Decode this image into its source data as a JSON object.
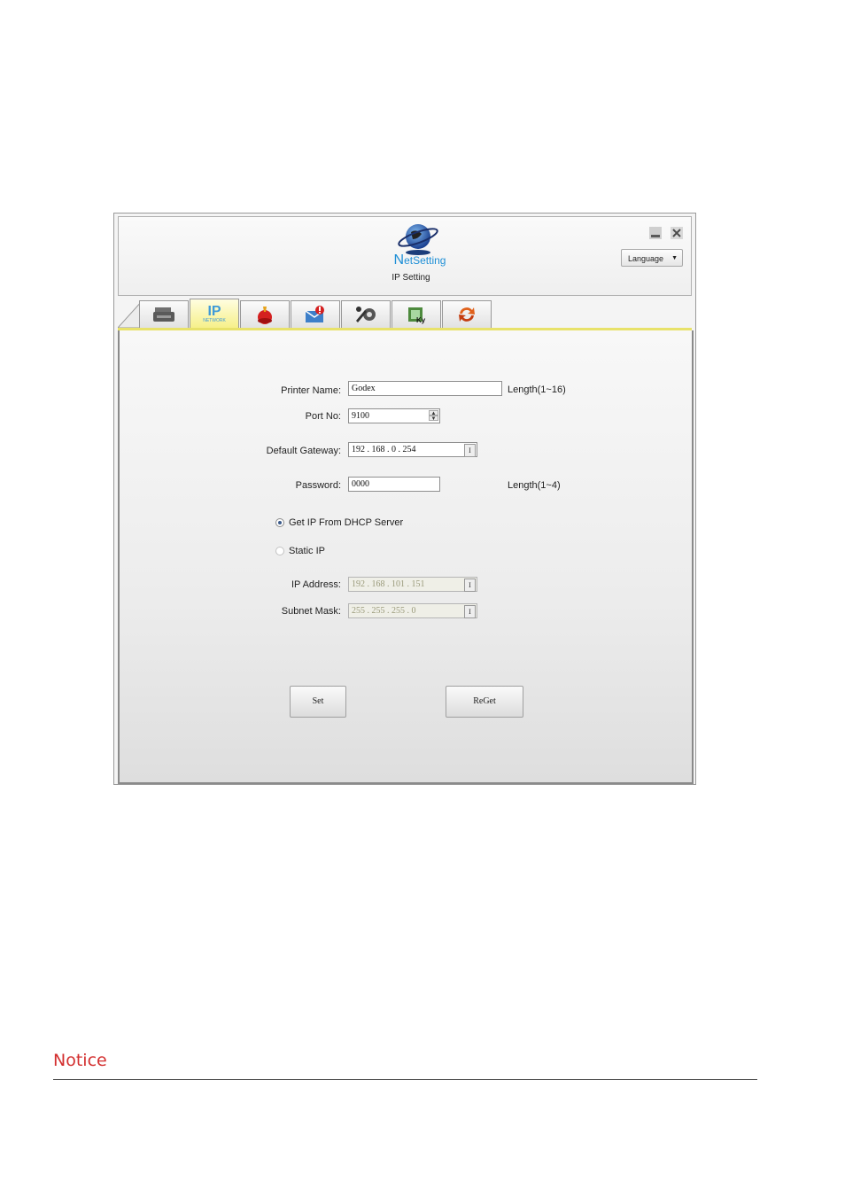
{
  "app": {
    "brand_first": "N",
    "brand_rest": "etSetting",
    "subtitle": "IP Setting",
    "language_label": "Language",
    "language_caret": "▼"
  },
  "tabs": [
    {
      "icon": "printer-icon"
    },
    {
      "icon": "ip-network-icon",
      "label": "IP",
      "sublabel": "NETWORK",
      "active": true
    },
    {
      "icon": "alert-bell-icon"
    },
    {
      "icon": "mail-alert-icon"
    },
    {
      "icon": "tools-icon"
    },
    {
      "icon": "key-icon"
    },
    {
      "icon": "refresh-icon"
    }
  ],
  "form": {
    "printer_name_label": "Printer Name:",
    "printer_name_value": "Godex",
    "printer_name_hint": "Length(1~16)",
    "port_label": "Port No:",
    "port_value": "9100",
    "gateway_label": "Default Gateway:",
    "gateway_value": "192 . 168 . 0 . 254",
    "password_label": "Password:",
    "password_value": "0000",
    "password_hint": "Length(1~4)",
    "dhcp_label": "Get IP From DHCP Server",
    "static_label": "Static IP",
    "ip_label": "IP Address:",
    "ip_value": "192 . 168 . 101 . 151",
    "mask_label": "Subnet Mask:",
    "mask_value": "255 . 255 . 255 . 0",
    "ip_button_glyph": "I",
    "spin_up": "▲",
    "spin_down": "▼"
  },
  "buttons": {
    "set": "Set",
    "reget": "ReGet"
  },
  "notice": {
    "title": "Notice"
  },
  "colors": {
    "accent": "#1e8fd6",
    "tab_active": "#f6f08a",
    "notice": "#d32f2f"
  }
}
